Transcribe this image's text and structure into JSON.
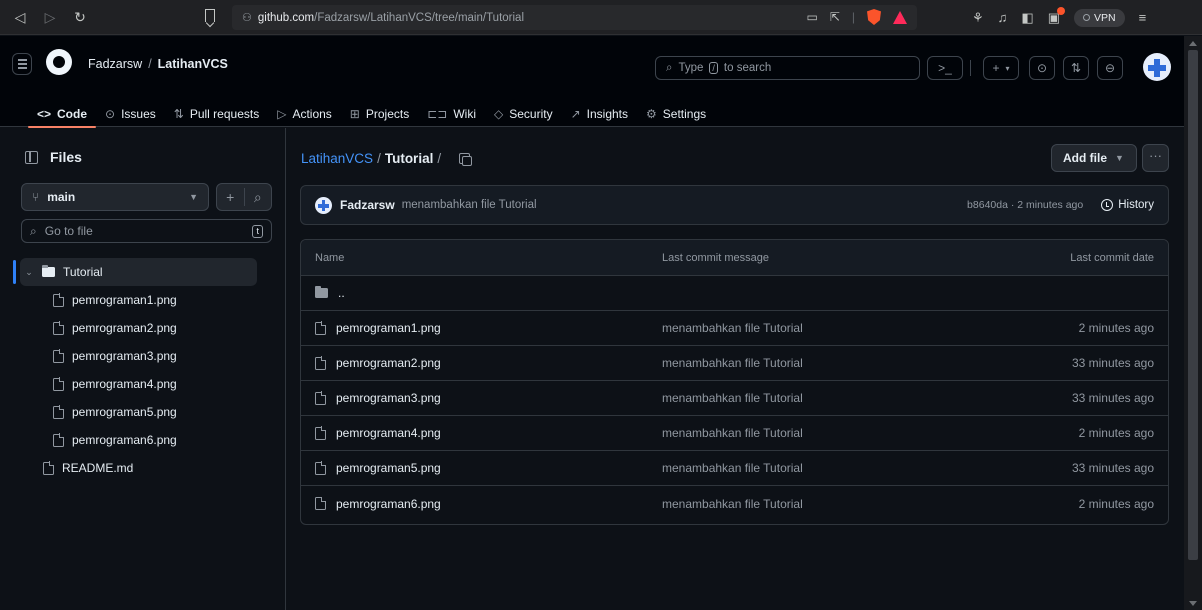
{
  "browser": {
    "url_host": "github.com",
    "url_path": "/Fadzarsw/LatihanVCS/tree/main/Tutorial",
    "vpn_label": "VPN"
  },
  "header": {
    "owner": "Fadzarsw",
    "separator": "/",
    "repo": "LatihanVCS",
    "search_placeholder_pre": "Type",
    "search_key": "/",
    "search_placeholder_post": "to search",
    "plus_label": "+"
  },
  "repo_nav": {
    "tabs": [
      {
        "icon": "<>",
        "label": "Code"
      },
      {
        "icon": "⊙",
        "label": "Issues"
      },
      {
        "icon": "⇅",
        "label": "Pull requests"
      },
      {
        "icon": "▷",
        "label": "Actions"
      },
      {
        "icon": "⊞",
        "label": "Projects"
      },
      {
        "icon": "⊏⊐",
        "label": "Wiki"
      },
      {
        "icon": "◇",
        "label": "Security"
      },
      {
        "icon": "↗",
        "label": "Insights"
      },
      {
        "icon": "⚙",
        "label": "Settings"
      }
    ]
  },
  "sidebar": {
    "title": "Files",
    "branch": "main",
    "goto_placeholder": "Go to file",
    "goto_key": "t",
    "tree": [
      {
        "label": "Tutorial",
        "type": "folder"
      },
      {
        "label": "pemrograman1.png",
        "type": "file"
      },
      {
        "label": "pemrograman2.png",
        "type": "file"
      },
      {
        "label": "pemrograman3.png",
        "type": "file"
      },
      {
        "label": "pemrograman4.png",
        "type": "file"
      },
      {
        "label": "pemrograman5.png",
        "type": "file"
      },
      {
        "label": "pemrograman6.png",
        "type": "file"
      },
      {
        "label": "README.md",
        "type": "file"
      }
    ]
  },
  "main": {
    "crumb_repo": "LatihanVCS",
    "crumb_sep": "/",
    "crumb_current": "Tutorial",
    "crumb_trailing": "/",
    "add_file_label": "Add file",
    "more_label": "···",
    "commit": {
      "author": "Fadzarsw",
      "message": "menambahkan file Tutorial",
      "meta": "b8640da · 2 minutes ago",
      "history_label": "History"
    },
    "table": {
      "headers": [
        "Name",
        "Last commit message",
        "Last commit date"
      ],
      "parent_label": "..",
      "rows": [
        {
          "name": "pemrograman1.png",
          "message": "menambahkan file Tutorial",
          "date": "2 minutes ago"
        },
        {
          "name": "pemrograman2.png",
          "message": "menambahkan file Tutorial",
          "date": "33 minutes ago"
        },
        {
          "name": "pemrograman3.png",
          "message": "menambahkan file Tutorial",
          "date": "33 minutes ago"
        },
        {
          "name": "pemrograman4.png",
          "message": "menambahkan file Tutorial",
          "date": "2 minutes ago"
        },
        {
          "name": "pemrograman5.png",
          "message": "menambahkan file Tutorial",
          "date": "33 minutes ago"
        },
        {
          "name": "pemrograman6.png",
          "message": "menambahkan file Tutorial",
          "date": "2 minutes ago"
        }
      ]
    }
  },
  "colors": {
    "accent_link": "#4493f8",
    "tab_underline": "#f78166",
    "background": "#0d1117"
  }
}
